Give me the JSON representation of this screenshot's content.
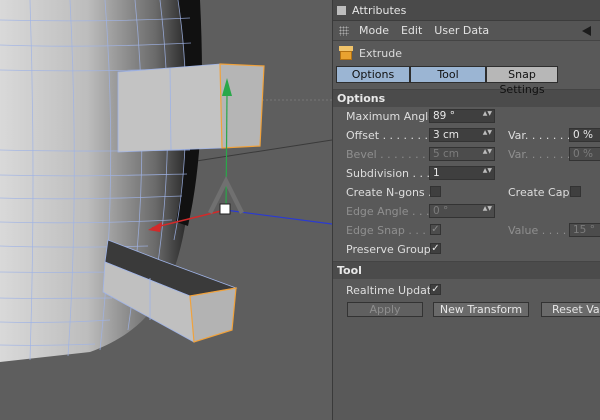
{
  "attributes": {
    "title": "Attributes",
    "menu": [
      "Mode",
      "Edit",
      "User Data"
    ],
    "object_name": "Extrude",
    "tabs": [
      "Options",
      "Tool",
      "Snap Settings"
    ]
  },
  "options": {
    "header": "Options",
    "max_angle": {
      "label": "Maximum Angle",
      "value": "89 °"
    },
    "offset": {
      "label": "Offset",
      "dots": ". . . . . . . .",
      "value": "3 cm"
    },
    "offset_var": {
      "label": "Var.",
      "dots": ". . . . . . .",
      "value": "0 %"
    },
    "bevel": {
      "label": "Bevel",
      "dots": ". . . . . . . .",
      "value": "5 cm"
    },
    "bevel_var": {
      "label": "Var.",
      "dots": ". . . . . . .",
      "value": "0 %"
    },
    "subdivision": {
      "label": "Subdivision",
      "dots": ". . . .",
      "value": "1"
    },
    "create_ngons": {
      "label": "Create N-gons",
      "dots": ". .",
      "checked": false
    },
    "create_caps": {
      "label": "Create Caps",
      "checked": false
    },
    "edge_angle": {
      "label": "Edge Angle",
      "dots": ". . .",
      "value": "0 °"
    },
    "edge_snap": {
      "label": "Edge Snap",
      "dots": ". . . .",
      "checked": true
    },
    "value": {
      "label": "Value",
      "dots": ". . . . .",
      "value": "15 °"
    },
    "preserve_groups": {
      "label": "Preserve Groups",
      "checked": true
    }
  },
  "tool": {
    "header": "Tool",
    "realtime_update": {
      "label": "Realtime Update",
      "checked": true
    },
    "buttons": {
      "apply": "Apply",
      "new_transform": "New Transform",
      "reset_values": "Reset Values"
    }
  },
  "glyphs": {
    "check": "✓",
    "spin": "▲▼"
  },
  "colors": {
    "tab_active": "#9bb5d3",
    "tab_inactive": "#b7b7b7",
    "axis_y": "#2aa84a",
    "axis_x": "#d22a2a",
    "axis_z": "#2a3ad2",
    "selection": "#f0a23c"
  }
}
